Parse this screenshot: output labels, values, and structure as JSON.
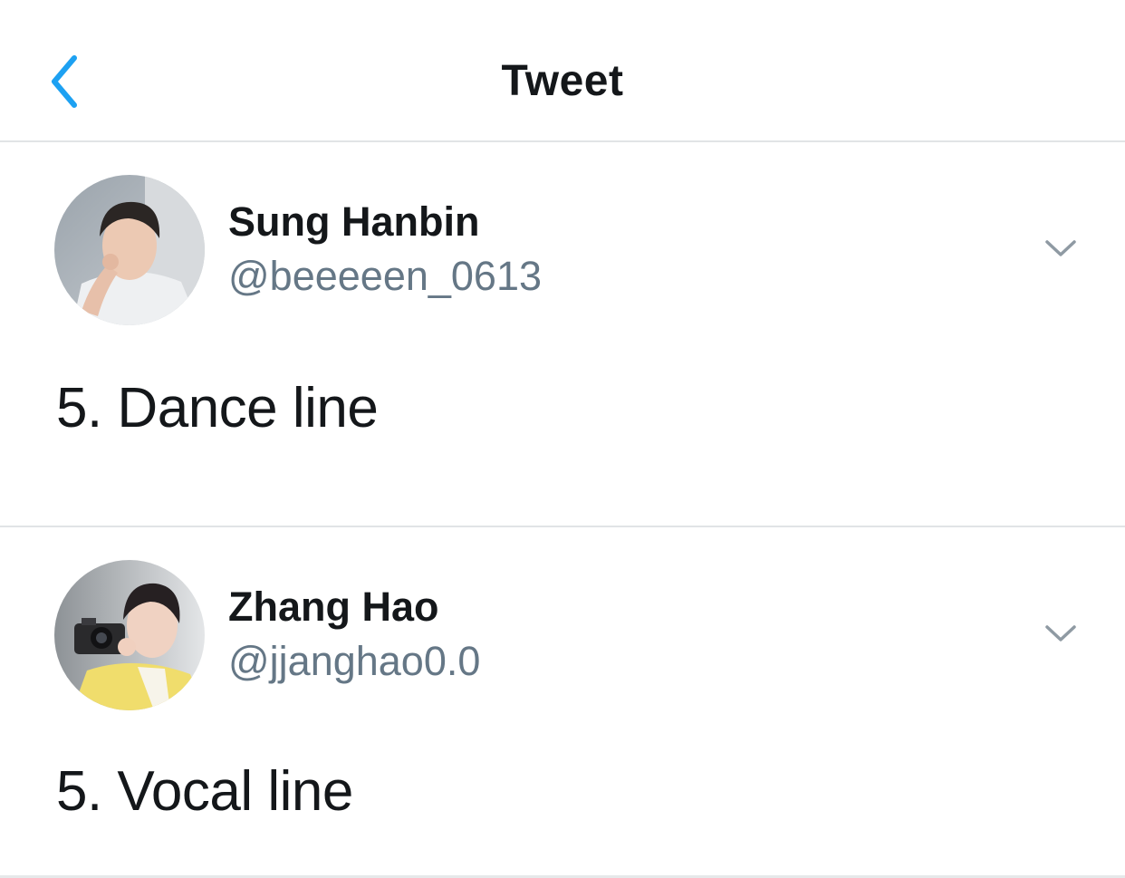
{
  "header": {
    "title": "Tweet",
    "back_icon": "chevron-left-icon",
    "accent_color": "#1da1f2"
  },
  "tweets": [
    {
      "display_name": "Sung Hanbin",
      "handle": "@beeeeen_0613",
      "text": "5. Dance line",
      "menu_icon": "chevron-down-icon"
    },
    {
      "display_name": "Zhang Hao",
      "handle": "@jjanghao0.0",
      "text": "5. Vocal line",
      "menu_icon": "chevron-down-icon"
    }
  ],
  "colors": {
    "text_primary": "#14171a",
    "text_secondary": "#657786",
    "divider": "#e1e4e6"
  }
}
